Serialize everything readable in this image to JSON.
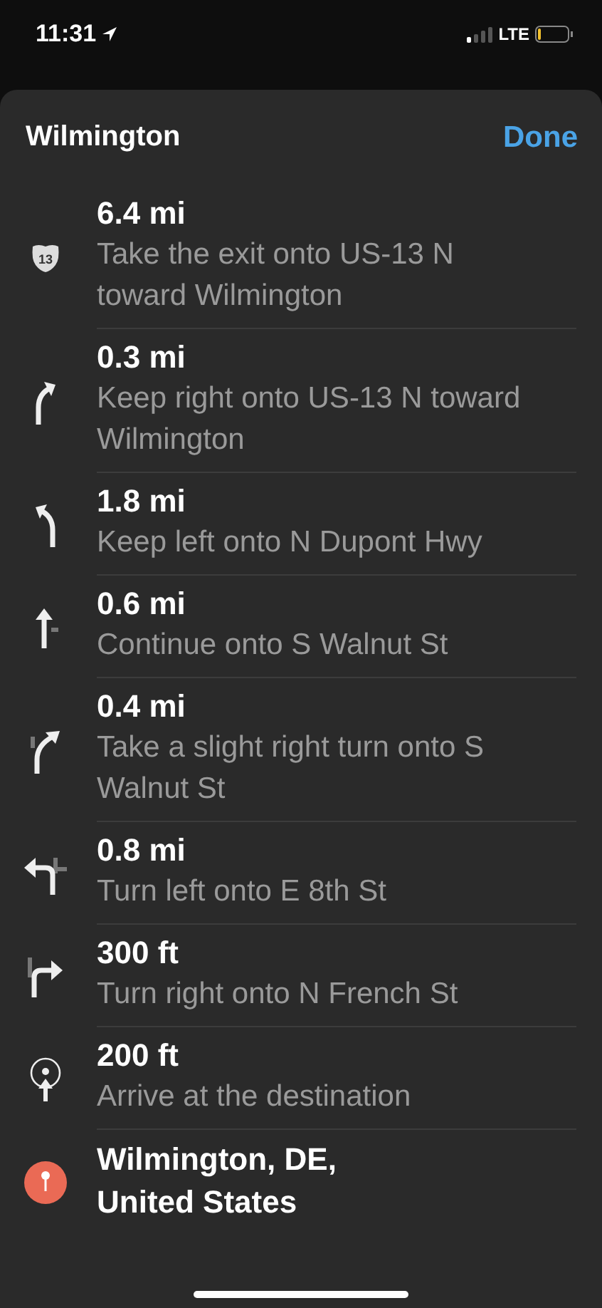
{
  "status_bar": {
    "time": "11:31",
    "network": "LTE"
  },
  "header": {
    "title": "Wilmington",
    "done": "Done"
  },
  "steps": [
    {
      "kind": "shield",
      "shield": "13",
      "distance": "6.4 mi",
      "instruction": "Take the exit onto US-13 N toward Wilmington"
    },
    {
      "kind": "keep-right",
      "distance": "0.3 mi",
      "instruction": "Keep right onto US-13 N toward Wilmington"
    },
    {
      "kind": "keep-left",
      "distance": "1.8 mi",
      "instruction": "Keep left onto N Dupont Hwy"
    },
    {
      "kind": "straight",
      "distance": "0.6 mi",
      "instruction": "Continue onto S Walnut St"
    },
    {
      "kind": "slight-right",
      "distance": "0.4 mi",
      "instruction": "Take a slight right turn onto S Walnut St"
    },
    {
      "kind": "left",
      "distance": "0.8 mi",
      "instruction": "Turn left onto E 8th St"
    },
    {
      "kind": "right",
      "distance": "300 ft",
      "instruction": "Turn right onto N French St"
    },
    {
      "kind": "arrive",
      "distance": "200 ft",
      "instruction": "Arrive at the destination"
    }
  ],
  "destination": {
    "name": "Wilmington, DE, United States"
  }
}
